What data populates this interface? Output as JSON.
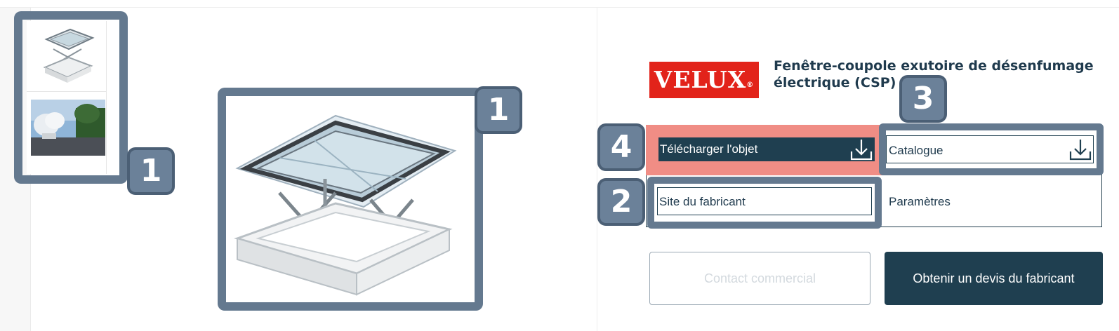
{
  "product": {
    "brand": "VELUX",
    "brand_mark": "®",
    "title_line1": "Fenêtre-coupole exutoire de désenfumage",
    "title_line2": "électrique (CSP)"
  },
  "thumbnails": [
    {
      "alt": "skylight-product-thumbnail"
    },
    {
      "alt": "skylight-smoke-photo-thumbnail"
    }
  ],
  "actions": {
    "download_object": "Télécharger l'objet",
    "catalog": "Catalogue",
    "manufacturer_site": "Site du fabricant",
    "parameters": "Paramètres"
  },
  "buttons": {
    "contact": "Contact commercial",
    "quote": "Obtenir un devis du fabricant"
  },
  "callouts": {
    "thumbnails": "1",
    "main_image": "1",
    "manufacturer_site": "2",
    "catalog": "3",
    "download": "4"
  },
  "colors": {
    "brand_red": "#e2231a",
    "dark_navy": "#1f3f50",
    "callout_slate": "#64798f",
    "highlight_salmon": "#f08d85"
  }
}
